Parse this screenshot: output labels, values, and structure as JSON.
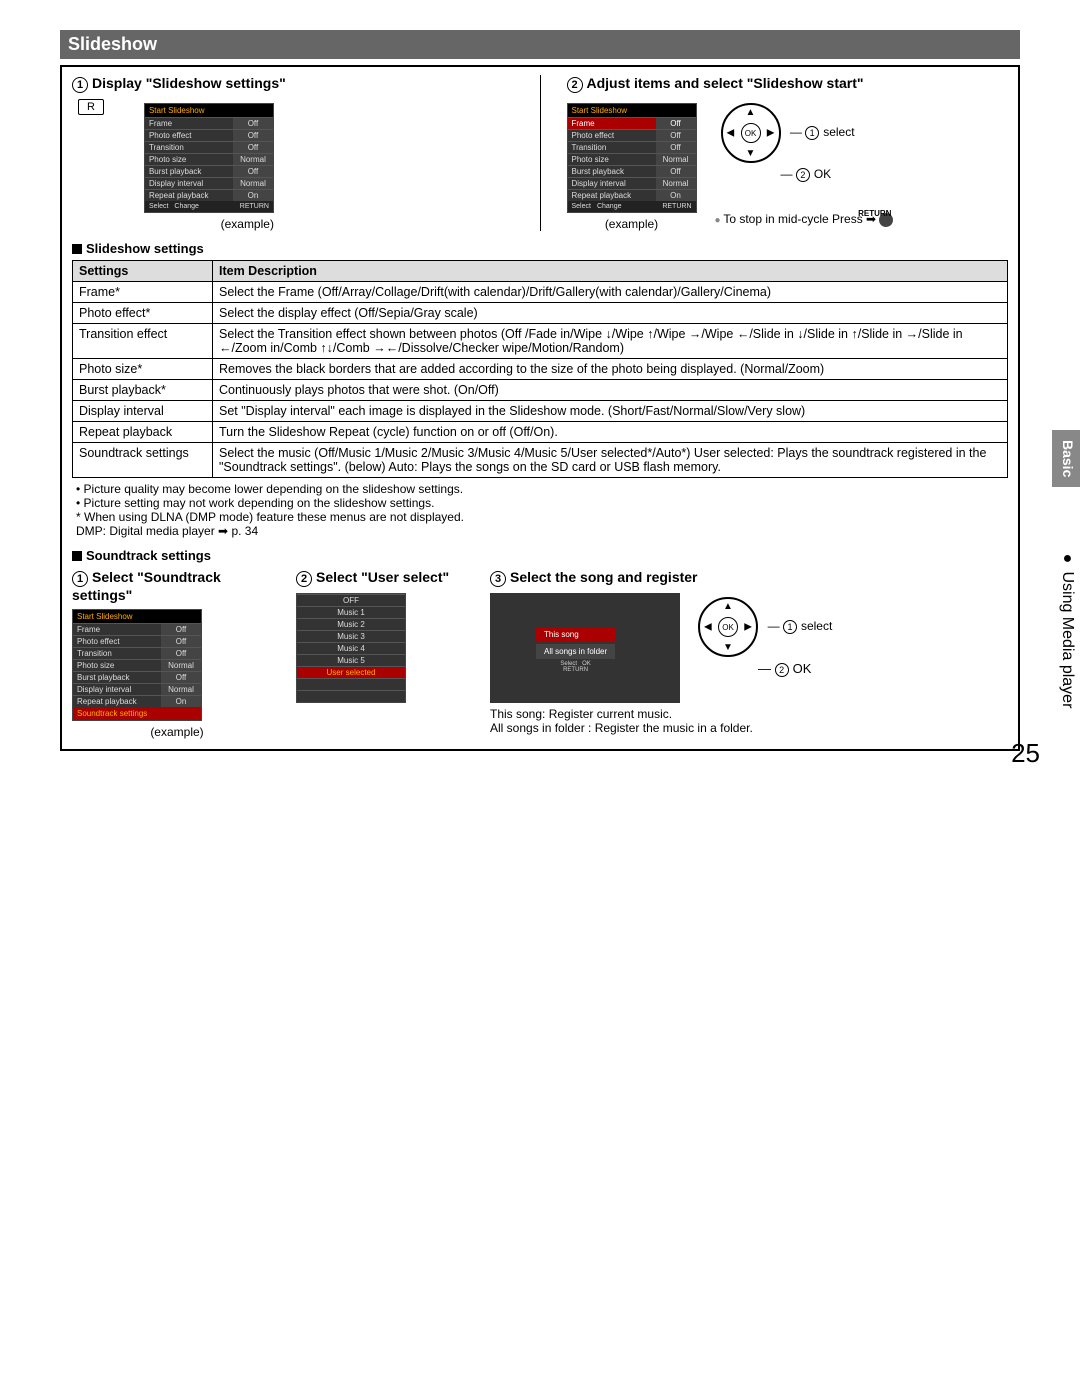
{
  "page_number": "25",
  "side_tab": "Basic",
  "side_text": "Using Media player",
  "header": "Slideshow",
  "step1": {
    "num": "1",
    "title": "Display \"Slideshow settings\"",
    "remote_key": "R",
    "menu_header": "Start Slideshow",
    "rows": [
      {
        "label": "Frame",
        "value": "Off"
      },
      {
        "label": "Photo effect",
        "value": "Off"
      },
      {
        "label": "Transition",
        "value": "Off"
      },
      {
        "label": "Photo size",
        "value": "Normal"
      },
      {
        "label": "Burst playback",
        "value": "Off"
      },
      {
        "label": "Display interval",
        "value": "Normal"
      },
      {
        "label": "Repeat playback",
        "value": "On"
      }
    ],
    "footer_select": "Select",
    "footer_change": "Change",
    "footer_return": "RETURN",
    "example": "(example)"
  },
  "step2": {
    "num": "2",
    "title": "Adjust items and select \"Slideshow start\"",
    "menu_header": "Start Slideshow",
    "rows": [
      {
        "label": "Frame",
        "value": "Off"
      },
      {
        "label": "Photo effect",
        "value": "Off"
      },
      {
        "label": "Transition",
        "value": "Off"
      },
      {
        "label": "Photo size",
        "value": "Normal"
      },
      {
        "label": "Burst playback",
        "value": "Off"
      },
      {
        "label": "Display interval",
        "value": "Normal"
      },
      {
        "label": "Repeat playback",
        "value": "On"
      }
    ],
    "example": "(example)",
    "select_label": "select",
    "ok_label": "OK",
    "stop_text": "To stop in mid-cycle Press",
    "return_label": "RETURN"
  },
  "settings_section_heading": "Slideshow settings",
  "table": {
    "head_settings": "Settings",
    "head_desc": "Item Description",
    "rows": [
      {
        "s": "Frame*",
        "d": "Select the Frame (Off/Array/Collage/Drift(with calendar)/Drift/Gallery(with calendar)/Gallery/Cinema)"
      },
      {
        "s": "Photo effect*",
        "d": "Select the display effect (Off/Sepia/Gray scale)"
      },
      {
        "s": "Transition effect",
        "d": "Select the Transition effect shown between photos (Off /Fade in/Wipe ↓/Wipe ↑/Wipe →/Wipe ←/Slide in ↓/Slide in ↑/Slide in →/Slide in ←/Zoom in/Comb ↑↓/Comb →←/Dissolve/Checker wipe/Motion/Random)"
      },
      {
        "s": "Photo size*",
        "d": "Removes the black borders that are added according to the size of the photo being displayed. (Normal/Zoom)"
      },
      {
        "s": "Burst playback*",
        "d": "Continuously plays photos that were shot. (On/Off)"
      },
      {
        "s": "Display interval",
        "d": "Set \"Display interval\" each image is displayed in the Slideshow mode. (Short/Fast/Normal/Slow/Very slow)"
      },
      {
        "s": "Repeat playback",
        "d": "Turn the Slideshow Repeat (cycle) function on or off (Off/On)."
      },
      {
        "s": "Soundtrack settings",
        "d": "Select the music (Off/Music 1/Music 2/Music 3/Music 4/Music 5/User selected*/Auto*) User selected: Plays the soundtrack registered in the \"Soundtrack settings\". (below) Auto: Plays the songs on the SD card or USB flash memory."
      }
    ]
  },
  "notes": [
    "• Picture quality may become lower depending on the slideshow settings.",
    "• Picture setting may not work depending on the slideshow settings.",
    "* When using DLNA (DMP mode) feature these menus are not displayed.",
    "  DMP: Digital media player ➡ p. 34"
  ],
  "soundtrack_heading": "Soundtrack settings",
  "sound_steps": {
    "s1": {
      "num": "1",
      "title": "Select \"Soundtrack settings\"",
      "menu_header": "Start Slideshow",
      "rows": [
        {
          "label": "Frame",
          "value": "Off"
        },
        {
          "label": "Photo effect",
          "value": "Off"
        },
        {
          "label": "Transition",
          "value": "Off"
        },
        {
          "label": "Photo size",
          "value": "Normal"
        },
        {
          "label": "Burst playback",
          "value": "Off"
        },
        {
          "label": "Display interval",
          "value": "Normal"
        },
        {
          "label": "Repeat playback",
          "value": "On"
        }
      ],
      "footer_row": "Soundtrack settings",
      "example": "(example)"
    },
    "s2": {
      "num": "2",
      "title": "Select \"User select\"",
      "items": [
        "OFF",
        "Music 1",
        "Music 2",
        "Music 3",
        "Music 4",
        "Music 5",
        "User selected"
      ]
    },
    "s3": {
      "num": "3",
      "title": "Select the song and register",
      "popup_this": "This song",
      "popup_all": "All songs in folder",
      "popup_select": "Select",
      "popup_ok": "OK",
      "popup_return": "RETURN",
      "select_label": "select",
      "ok_label": "OK",
      "desc1": "This song: Register current music.",
      "desc2": "All songs in folder : Register the music in a folder."
    }
  }
}
